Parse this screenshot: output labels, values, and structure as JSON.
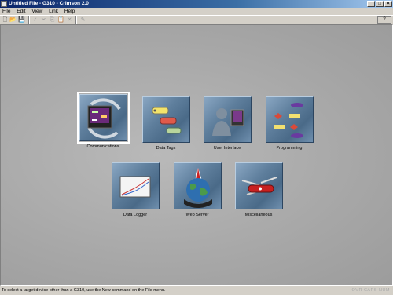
{
  "window": {
    "title": "Untitled File - G310 - Crimson 2.0"
  },
  "menu": {
    "file": "File",
    "edit": "Edit",
    "view": "View",
    "link": "Link",
    "help": "Help"
  },
  "toolbar": {
    "help_button": "?"
  },
  "tiles": {
    "communications": "Communications",
    "data_tags": "Data Tags",
    "user_interface": "User Interface",
    "programming": "Programming",
    "data_logger": "Data Logger",
    "web_server": "Web Server",
    "miscellaneous": "Miscellaneous"
  },
  "status": {
    "message": "To select a target device other than a G310, use the New command on the File menu.",
    "indicators": "OVR CAPS NUM"
  }
}
